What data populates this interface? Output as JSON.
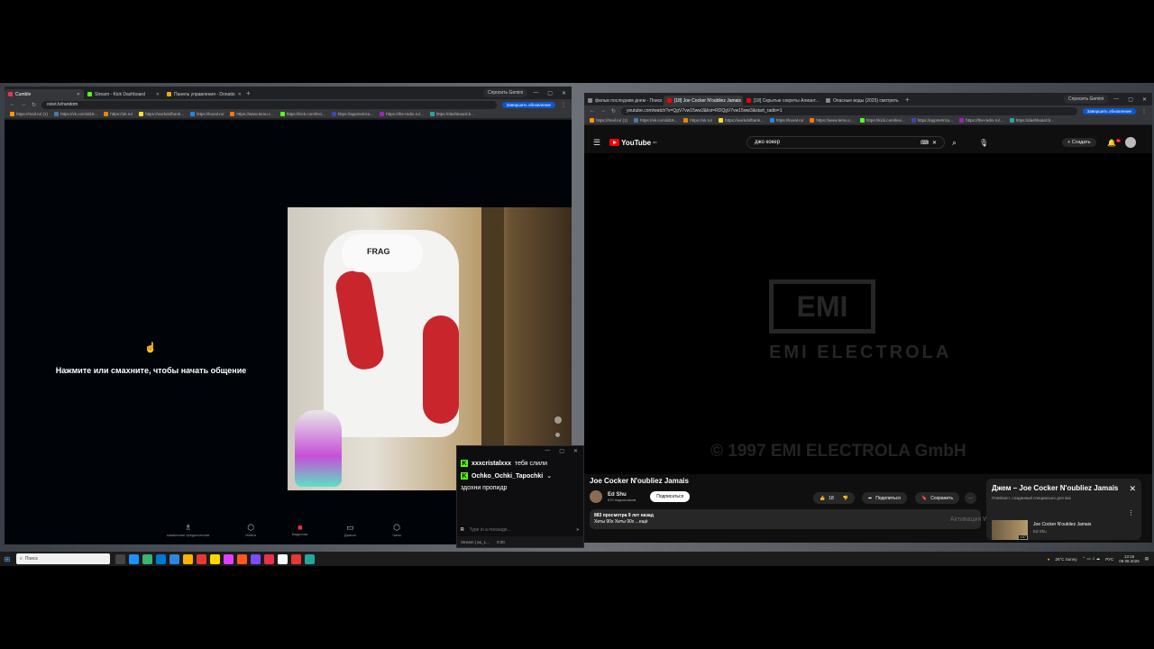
{
  "left_window": {
    "tabs": [
      {
        "label": "Cumble",
        "color": "#e8334a",
        "active": true
      },
      {
        "label": "Stream - Kick Dashboard",
        "color": "#53fc18"
      },
      {
        "label": "Панель управления - Donatio",
        "color": "#f2a900"
      }
    ],
    "gemini_label": "Спросить Gemini",
    "url": "oviet.tv/random",
    "update_label": "Завершить обновление",
    "bookmarks": [
      "https://mail.ru/ (1)",
      "https://vk.com/id19...",
      "https://ok.ru/",
      "https://workdofbank...",
      "https://koval.ru/",
      "https://www.temu.c...",
      "https://kick.com/lexi...",
      "https://appmetrica...",
      "https://the-radio.ru/...",
      "https://dashboard.b..."
    ],
    "tap_icon": "☝",
    "tap_text": "Нажмите или смахните, чтобы начать общение",
    "camera_badge": "FRAG",
    "nav_items": [
      {
        "label": "изменение предпочтения",
        "icon": "♗"
      },
      {
        "label": "Найти",
        "icon": "⬡"
      },
      {
        "label": "Видеочат",
        "icon": "■"
      },
      {
        "label": "Диалог",
        "icon": "▭"
      },
      {
        "label": "Чаты",
        "icon": "⬡"
      }
    ]
  },
  "chat_popup": {
    "messages": [
      {
        "user": "xxxcristalxxx",
        "text": "тебя слили"
      },
      {
        "user": "Ochko_Ochki_Tapochki",
        "text": ""
      },
      {
        "user": "",
        "text": "здохни пропидр"
      }
    ],
    "input_placeholder": "Type in a message...",
    "footer": "Stream | au_L...",
    "footer_time": "0:00"
  },
  "right_window": {
    "tabs": [
      {
        "label": "фильм последним днем - Поиск",
        "color": "#888888"
      },
      {
        "label": "[18] Joe Cocker N'oubliez Jamais",
        "color": "#ff0000",
        "active": true
      },
      {
        "label": "[18] Скрытые секреты Алиант...",
        "color": "#ff0000"
      },
      {
        "label": "Опасные воды (2025) смотреть",
        "color": "#888888"
      }
    ],
    "gemini_label": "Спросить Gemini",
    "url": "youtube.com/watch?v=QgV7vw15ww3&list=RDQgV7vw15ww3&start_radio=1",
    "update_label": "Завершить обновление",
    "bookmarks": [
      "https://mail.ru/ (1)",
      "https://vk.com/id19...",
      "https://ok.ru/",
      "https://workdofbank...",
      "https://koval.ru/",
      "https://www.temu.c...",
      "https://kick.com/lexi...",
      "https://appmetrica...",
      "https://the-radio.ru/...",
      "https://dashboard.b..."
    ]
  },
  "youtube": {
    "logo": "YouTube",
    "region": "NO",
    "search_value": "джо кокер",
    "create_label": "Создать",
    "notif_count": "9+",
    "video_logo": "EMI",
    "video_brand": "EMI ELECTROLA",
    "video_copyright": "© 1997 EMI ELECTROLA GmbH",
    "title": "Joe Cocker N'oubliez Jamais",
    "channel": "Ed Shu",
    "subscribers": "670 подписчиков",
    "subscribe_label": "Подписаться",
    "likes": "18",
    "share_label": "Поделиться",
    "save_label": "Сохранить",
    "views": "883 просмотра  9 лет назад",
    "tags": "Хиты 90х Хиты 90х ...ещё",
    "activation_text": "Активация Windows",
    "mini_title": "Джем – Joe Cocker N'oubliez Jamais",
    "mini_subtitle": "Плейлист, созданный специально для вас",
    "mini_track": "Joe Cocker N'oubliez Jamais",
    "mini_track_channel": "Ed Shu",
    "mini_duration": "4:57"
  },
  "taskbar": {
    "search_placeholder": "Поиск",
    "weather": "26°C  Sunny",
    "lang": "РУС",
    "time": "13:15",
    "date": "09.08.2025",
    "app_colors": [
      "#444444",
      "#1e90ff",
      "#3cb371",
      "#0078d4",
      "#2e86de",
      "#ffb300",
      "#e53935",
      "#ffd600",
      "#e040fb",
      "#ff5722",
      "#7c4dff",
      "#e8334a",
      "#ffffff",
      "#e53935",
      "#26a69a"
    ]
  }
}
